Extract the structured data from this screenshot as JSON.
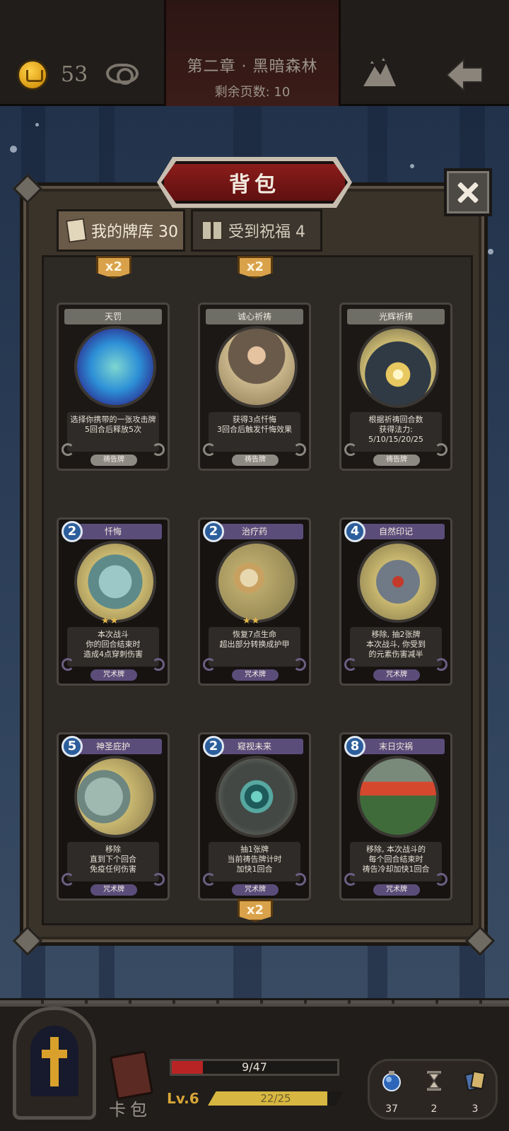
{
  "topbar": {
    "coins": "53",
    "chapter_title": "第二章 · 黑暗森林",
    "pages_left": "剩余页数: 10"
  },
  "panel": {
    "title": "背包",
    "tabs": [
      {
        "label": "我的牌库 30"
      },
      {
        "label": "受到祝福 4"
      }
    ],
    "multipliers": [
      "x2",
      "x2",
      "x2"
    ]
  },
  "cards": [
    {
      "name": "天罚",
      "desc": "选择你携带的一张攻击牌\n5回合后释放5次",
      "type": "祷告牌",
      "cost": ""
    },
    {
      "name": "诚心祈祷",
      "desc": "获得3点忏悔\n3回合后触发忏悔效果",
      "type": "祷告牌",
      "cost": ""
    },
    {
      "name": "光辉祈祷",
      "desc": "根据祈祷回合数\n获得法力:\n5/10/15/20/25",
      "type": "祷告牌",
      "cost": ""
    },
    {
      "name": "忏悔",
      "desc": "本次战斗\n你的回合结束时\n造成4点穿刺伤害",
      "type": "咒术牌",
      "cost": "2",
      "stars": "★★"
    },
    {
      "name": "治疗药",
      "desc": "恢复7点生命\n超出部分转换成护甲",
      "type": "咒术牌",
      "cost": "2",
      "stars": "★★"
    },
    {
      "name": "自然印记",
      "desc": "移除, 抽2张牌\n本次战斗, 你受到\n的元素伤害减半",
      "type": "咒术牌",
      "cost": "4"
    },
    {
      "name": "神圣庇护",
      "desc": "移除\n直到下个回合\n免疫任何伤害",
      "type": "咒术牌",
      "cost": "5"
    },
    {
      "name": "窥视未来",
      "desc": "抽1张牌\n当前祷告牌计时\n加快1回合",
      "type": "咒术牌",
      "cost": "2"
    },
    {
      "name": "末日灾祸",
      "desc": "移除, 本次战斗的\n每个回合结束时\n祷告冷却加快1回合",
      "type": "咒术牌",
      "cost": "8"
    }
  ],
  "hud": {
    "hp_text": "9/47",
    "hp_fraction": 0.19,
    "level": "Lv.6",
    "xp_text": "22/25",
    "xp_fraction": 0.88,
    "cardbag_label": "卡包",
    "resources": [
      {
        "icon": "mana-orb-icon",
        "count": "37"
      },
      {
        "icon": "hourglass-icon",
        "count": "2"
      },
      {
        "icon": "cards-icon",
        "count": "3"
      }
    ]
  },
  "colors": {
    "prayer_card": "#6e6d66",
    "spell_card": "#5b4d7a",
    "cost_badge": "#2c5e9c",
    "hp": "#b82424",
    "xp": "#d7b741",
    "accent_gold": "#d9a24a"
  }
}
